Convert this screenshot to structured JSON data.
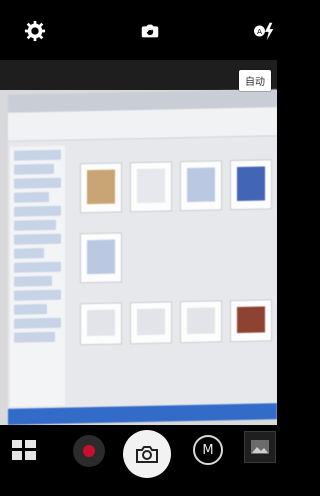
{
  "topbar": {
    "settings_icon": "gear-icon",
    "switch_camera_icon": "switch-camera-icon",
    "flash_icon": "flash-auto-icon"
  },
  "overlay": {
    "auto_label": "自动"
  },
  "bottombar": {
    "modes_icon": "grid-icon",
    "record_icon": "record-icon",
    "shutter_icon": "camera-icon",
    "manual_label": "M",
    "gallery_icon": "gallery-icon"
  },
  "colors": {
    "record_red": "#c8102e",
    "shutter_bg": "#f2f2f2",
    "topbar_bg": "#000000"
  }
}
